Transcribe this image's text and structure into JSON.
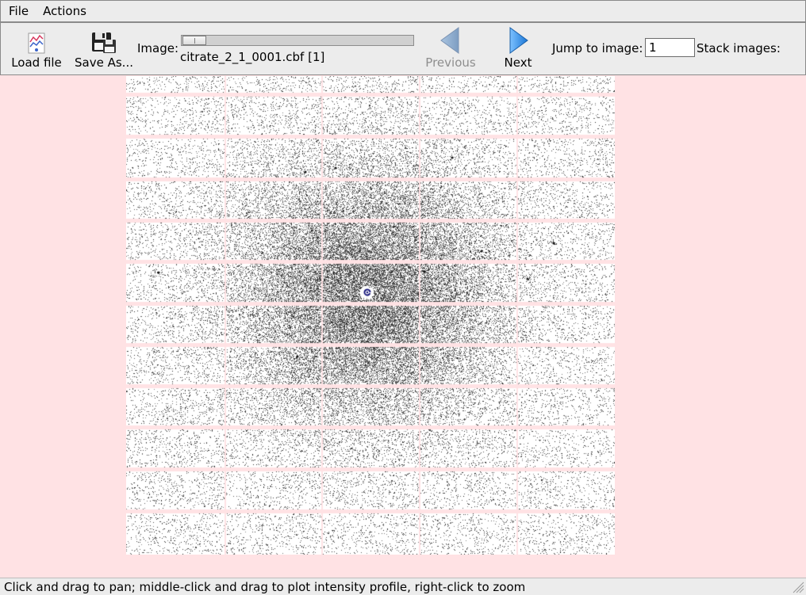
{
  "menubar": {
    "items": [
      "File",
      "Actions"
    ]
  },
  "toolbar": {
    "load_label": "Load file",
    "save_label": "Save As...",
    "image_label": "Image:",
    "image_name": "citrate_2_1_0001.cbf [1]",
    "previous_label": "Previous",
    "next_label": "Next",
    "jump_label": "Jump to image:",
    "jump_value": "1",
    "stack_label": "Stack images:"
  },
  "viewer": {
    "background": "#ffe2e4",
    "gap_color": "#ffe2e4",
    "detector_columns": 5,
    "detector_rows": 12
  },
  "status": {
    "text": "Click and drag to pan; middle-click and drag to plot intensity profile, right-click to zoom"
  },
  "colors": {
    "accent": "#2f8fe6",
    "disabled_arrow": "#8aa8c8",
    "chrome": "#ececec"
  },
  "icons": {
    "load": "chart-load-icon",
    "save": "floppy-disk-icon",
    "previous": "triangle-left-icon",
    "next": "triangle-right-icon",
    "grip": "resize-grip-icon"
  }
}
